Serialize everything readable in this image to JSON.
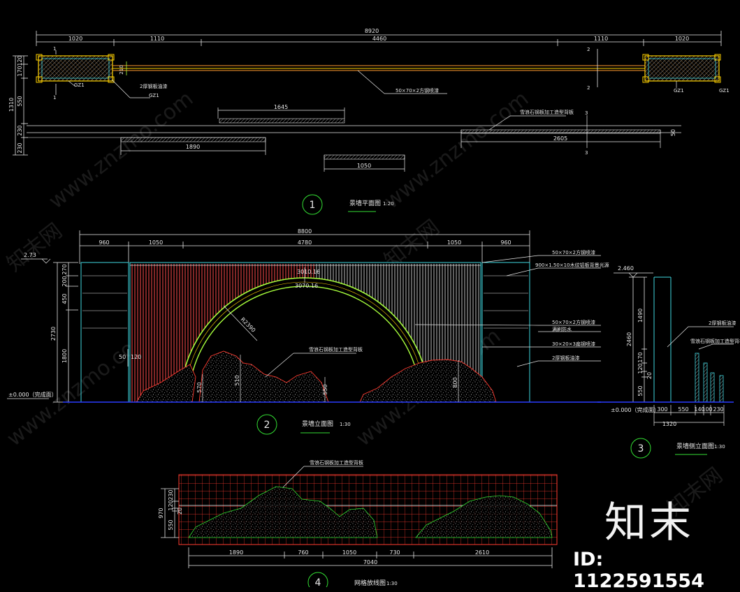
{
  "plan": {
    "dims_top": [
      "1020",
      "1110",
      "4460",
      "1110",
      "1020"
    ],
    "dim_total": "8920",
    "dims_left": [
      "120",
      "170",
      "550",
      "230"
    ],
    "dim_left_total": "1310",
    "left_small": [
      "210",
      "210"
    ],
    "col_label": "GZ1",
    "steel_label": "2厚钢板油漆",
    "pipe_label": "50×70×2方钢喷漆",
    "section_marks": [
      "1",
      "2",
      "3"
    ],
    "dim_1645": "1645",
    "dim_1890": "1890",
    "dim_1050": "1050",
    "dim_2605": "2605",
    "dim_50": "50",
    "rock_label": "雪浪石钢板加工造型背板",
    "title_num": "1",
    "title": "景墙平面图",
    "scale": "1:20"
  },
  "elev": {
    "dims_top": [
      "960",
      "1050",
      "4780",
      "1050",
      "960"
    ],
    "dim_total": "8800",
    "lvl_top": "2.73",
    "lvl_base": "±0.000（完成面）",
    "dims_left": [
      "270",
      "200",
      "450",
      "1800"
    ],
    "dim_left_total": "2730",
    "dim_arch1": "3010.16",
    "dim_arch2": "3070.16",
    "dim_radius": "R2390",
    "dim_50": "50",
    "dim_120": "120",
    "dim_570": "570",
    "dim_510": "510",
    "dim_550": "550",
    "dim_800": "800",
    "labels": [
      "50×70×2方钢喷漆",
      "900×1.50×10木纹铝板背景光源",
      "50×70×2方钢喷漆",
      "满刷防水",
      "30×20×3扁钢喷漆",
      "2厚钢板油漆"
    ],
    "rock_label": "雪浪石钢板加工造型背板",
    "title_num": "2",
    "title": "景墙立面图",
    "scale": "1:30"
  },
  "side": {
    "lvl_top": "2.460",
    "dim_1490": "1490",
    "dim_2460": "2460",
    "dims_small": [
      "170",
      "120",
      "20"
    ],
    "dim_550": "550",
    "lvl_base": "±0.000（完成面）",
    "dims_bottom": [
      "300",
      "550",
      "140",
      "100",
      "230"
    ],
    "dim_total": "1320",
    "labels": [
      "2厚钢板油漆",
      "雪浪石钢板加工造型背板"
    ],
    "title_num": "3",
    "title": "景墙侧立面图",
    "scale": "1:30"
  },
  "grid": {
    "rock_label": "雪浪石钢板加工造型背板",
    "dims_left": [
      "230",
      "120",
      "20",
      "550"
    ],
    "dim_left_total": "970",
    "dims_bottom": [
      "1890",
      "760",
      "1050",
      "730",
      "2610"
    ],
    "dim_total": "7040",
    "title_num": "4",
    "title": "网格放线图",
    "scale": "1:30"
  },
  "watermark": {
    "text": "www.znzmo.com",
    "brand": "知末网",
    "logo": "知末",
    "id": "ID: 1122591554"
  },
  "colors": {
    "background": "#000000",
    "line_white": "#e8e8e8",
    "line_yellow": "#ffd200",
    "line_cyan": "#3fd8e0",
    "line_green": "#a8ff3c",
    "line_red": "#ff3b30",
    "circle_green": "#33dd33",
    "ground_blue": "#2a3cff"
  }
}
